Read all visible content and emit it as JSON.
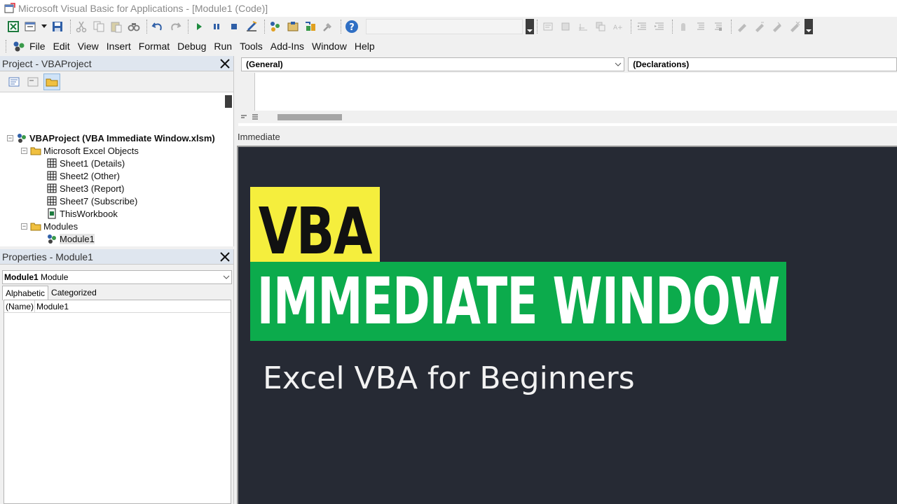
{
  "window": {
    "title": "Microsoft Visual Basic for Applications - [Module1 (Code)]"
  },
  "toolbar": {
    "buttons": [
      "view-excel",
      "insert-userform",
      "save",
      "cut",
      "copy",
      "paste",
      "find",
      "undo",
      "redo",
      "run",
      "break",
      "reset",
      "design-mode",
      "project-explorer",
      "properties-window",
      "object-browser",
      "toolbox",
      "help"
    ],
    "edit_buttons": [
      "list-properties",
      "list-constants",
      "quick-info",
      "parameter-info",
      "complete-word",
      "outdent",
      "indent",
      "toggle-breakpoint",
      "comment-block",
      "uncomment-block",
      "toggle-bookmark",
      "next-bookmark",
      "previous-bookmark",
      "clear-bookmarks"
    ]
  },
  "menu": {
    "items": [
      "File",
      "Edit",
      "View",
      "Insert",
      "Format",
      "Debug",
      "Run",
      "Tools",
      "Add-Ins",
      "Window",
      "Help"
    ]
  },
  "project": {
    "title": "Project - VBAProject",
    "root": "VBAProject (VBA Immediate Window.xlsm)",
    "folder_excel": "Microsoft Excel Objects",
    "sheets": [
      "Sheet1 (Details)",
      "Sheet2 (Other)",
      "Sheet3 (Report)",
      "Sheet7 (Subscribe)"
    ],
    "workbook": "ThisWorkbook",
    "folder_modules": "Modules",
    "module": "Module1"
  },
  "properties": {
    "title": "Properties - Module1",
    "object_name": "Module1",
    "object_type": "Module",
    "tab_alphabetic": "Alphabetic",
    "tab_categorized": "Categorized",
    "rows": [
      {
        "key": "(Name)",
        "value": "Module1"
      }
    ]
  },
  "code": {
    "object_combo": "(General)",
    "procedure_combo": "(Declarations)"
  },
  "immediate": {
    "title": "Immediate"
  },
  "overlay": {
    "line1": "VBA",
    "line2": "IMMEDIATE WINDOW",
    "subtitle": "Excel VBA for Beginners",
    "colors": {
      "yellow": "#f5ee3d",
      "green": "#0cab4c",
      "background": "#262a34"
    }
  }
}
